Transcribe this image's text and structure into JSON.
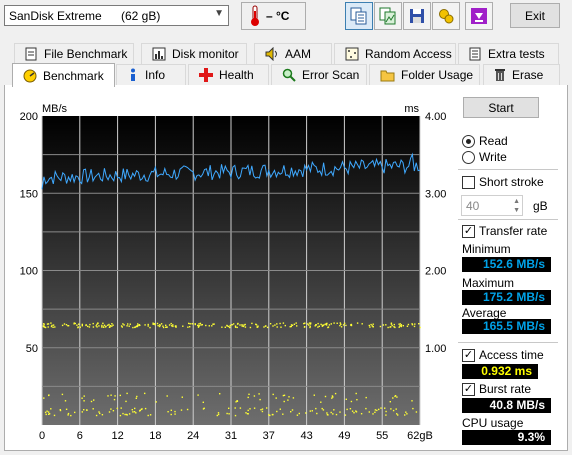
{
  "drive": {
    "name": "SanDisk Extreme",
    "size": "(62 gB)"
  },
  "temperature": "– °C",
  "toolbar": {
    "buttons": [
      "copy-text-icon",
      "copy-image-icon",
      "save-icon",
      "options-icon",
      "download-icon"
    ],
    "exit_label": "Exit"
  },
  "tabs_row1": [
    "File Benchmark",
    "Disk monitor",
    "AAM",
    "Random Access",
    "Extra tests"
  ],
  "tabs_row2": [
    "Benchmark",
    "Info",
    "Health",
    "Error Scan",
    "Folder Usage",
    "Erase"
  ],
  "selected_tab": "Benchmark",
  "chart_data": {
    "type": "line",
    "ylabel_left": "MB/s",
    "ylabel_right": "ms",
    "ylim_left": [
      0,
      200
    ],
    "ylim_right": [
      0,
      4.0
    ],
    "left_ticks": [
      "200",
      "150",
      "100",
      "50"
    ],
    "right_ticks": [
      "4.00",
      "3.00",
      "2.00",
      "1.00"
    ],
    "x_ticks": [
      "0",
      "6",
      "12",
      "18",
      "24",
      "31",
      "37",
      "43",
      "49",
      "55",
      "62gB"
    ],
    "xlim": [
      0,
      62
    ],
    "grid": true,
    "series": [
      {
        "color": "#3fa9ff",
        "min": 152.6,
        "max": 175.2,
        "avg": 165.5
      },
      {
        "color": "#ffff33",
        "access_time_ms": 0.932
      }
    ]
  },
  "controls": {
    "start_label": "Start",
    "read_label": "Read",
    "write_label": "Write",
    "mode": "Read",
    "short_stroke_label": "Short stroke",
    "short_stroke_checked": false,
    "short_stroke_value": "40",
    "short_stroke_unit": "gB",
    "transfer_rate_label": "Transfer rate",
    "transfer_rate_checked": true,
    "minimum_label": "Minimum",
    "minimum_value": "152.6 MB/s",
    "maximum_label": "Maximum",
    "maximum_value": "175.2 MB/s",
    "average_label": "Average",
    "average_value": "165.5 MB/s",
    "access_time_label": "Access time",
    "access_time_checked": true,
    "access_time_value": "0.932 ms",
    "burst_rate_label": "Burst rate",
    "burst_rate_checked": true,
    "burst_rate_value": "40.8 MB/s",
    "cpu_usage_label": "CPU usage",
    "cpu_usage_value": "9.3%"
  }
}
